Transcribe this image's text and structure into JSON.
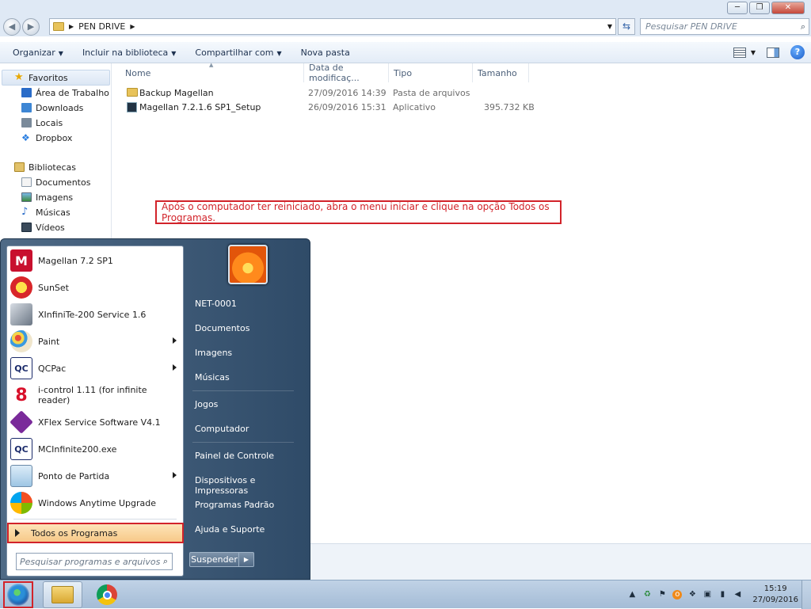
{
  "explorer": {
    "address": "PEN DRIVE",
    "search_placeholder": "Pesquisar PEN DRIVE",
    "toolbar": [
      "Organizar",
      "Incluir na biblioteca",
      "Compartilhar com",
      "Nova pasta"
    ],
    "columns": [
      "Nome",
      "Data de modificaç...",
      "Tipo",
      "Tamanho"
    ],
    "files": [
      {
        "name": "Backup Magellan",
        "date": "27/09/2016 14:39",
        "type": "Pasta de arquivos",
        "size": ""
      },
      {
        "name": "Magellan 7.2.1.6 SP1_Setup",
        "date": "26/09/2016 15:31",
        "type": "Aplicativo",
        "size": "395.732 KB"
      }
    ],
    "nav": {
      "favorites_label": "Favoritos",
      "favorites": [
        "Área de Trabalho",
        "Downloads",
        "Locais",
        "Dropbox"
      ],
      "libraries_label": "Bibliotecas",
      "libraries": [
        "Documentos",
        "Imagens",
        "Músicas",
        "Vídeos"
      ]
    }
  },
  "annotation": "Após o computador ter reiniciado, abra o menu iniciar e clique na opção Todos os Programas.",
  "start_menu": {
    "programs": [
      {
        "label": "Magellan 7.2 SP1",
        "icon": "magellan-icon",
        "submenu": false
      },
      {
        "label": "SunSet",
        "icon": "sunset-icon",
        "submenu": false
      },
      {
        "label": "XInfiniTe-200 Service 1.6",
        "icon": "xinfinite-icon",
        "submenu": false
      },
      {
        "label": "Paint",
        "icon": "paint-icon",
        "submenu": true
      },
      {
        "label": "QCPac",
        "icon": "qcpac-icon",
        "submenu": true
      },
      {
        "label": "i-control 1.11 (for infinite reader)",
        "icon": "i-control-icon",
        "submenu": false
      },
      {
        "label": "XFlex Service Software V4.1",
        "icon": "xflex-icon",
        "submenu": false
      },
      {
        "label": "MCInfinite200.exe",
        "icon": "mcinfinite-icon",
        "submenu": false
      },
      {
        "label": "Ponto de Partida",
        "icon": "getting-started-icon",
        "submenu": true
      },
      {
        "label": "Windows Anytime Upgrade",
        "icon": "windows-upgrade-icon",
        "submenu": false
      }
    ],
    "all_programs": "Todos os Programas",
    "search_placeholder": "Pesquisar programas e arquivos",
    "right_links": [
      "NET-0001",
      "Documentos",
      "Imagens",
      "Músicas",
      "Jogos",
      "Computador",
      "Painel de Controle",
      "Dispositivos e Impressoras",
      "Programas Padrão",
      "Ajuda e Suporte"
    ],
    "shutdown_label": "Suspender"
  },
  "taskbar": {
    "time": "15:19",
    "date": "27/09/2016"
  },
  "colors": {
    "annotation_red": "#d2232a",
    "highlight": "#f7c988",
    "startmenu_bg": "#3e5a78"
  }
}
